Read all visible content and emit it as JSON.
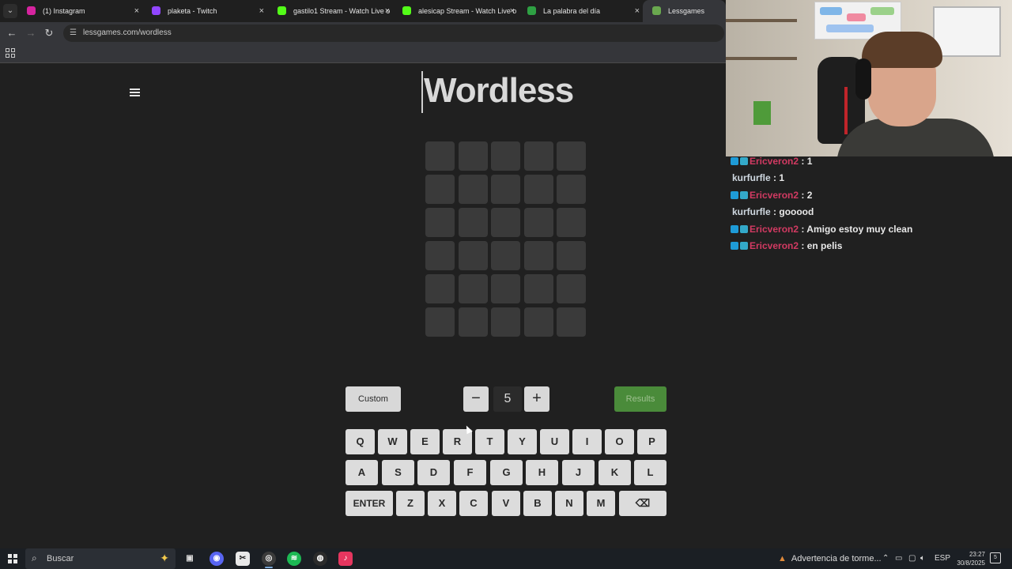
{
  "browser": {
    "tabs": [
      {
        "title": "(1) Instagram",
        "icon": "instagram-icon",
        "color": "#d6249f"
      },
      {
        "title": "plaketa - Twitch",
        "icon": "twitch-icon",
        "color": "#9146ff"
      },
      {
        "title": "gastilo1 Stream - Watch Live o",
        "icon": "kick-icon",
        "color": "#53fc18"
      },
      {
        "title": "alesicap Stream - Watch Live o",
        "icon": "kick-icon",
        "color": "#53fc18"
      },
      {
        "title": "La palabra del día",
        "icon": "p-logo-icon",
        "color": "#2ea043"
      },
      {
        "title": "Lessgames",
        "icon": "lessgames-icon",
        "color": "#6aa84f"
      }
    ],
    "url": "lessgames.com/wordless"
  },
  "game": {
    "title": "Wordless",
    "rows": 6,
    "cols": 5,
    "custom_label": "Custom",
    "minus_label": "−",
    "plus_label": "+",
    "word_length": "5",
    "results_label": "Results",
    "keyboard": {
      "row1": [
        "Q",
        "W",
        "E",
        "R",
        "T",
        "Y",
        "U",
        "I",
        "O",
        "P"
      ],
      "row2": [
        "A",
        "S",
        "D",
        "F",
        "G",
        "H",
        "J",
        "K",
        "L"
      ],
      "row3": [
        "ENTER",
        "Z",
        "X",
        "C",
        "V",
        "B",
        "N",
        "M",
        "⌫"
      ]
    }
  },
  "chat": {
    "messages": [
      {
        "user": "Ericveron2",
        "text": ": 1",
        "badges": true
      },
      {
        "user": "kurfurfle",
        "text": ": 1",
        "badges": false
      },
      {
        "user": "Ericveron2",
        "text": ": 2",
        "badges": true
      },
      {
        "user": "kurfurfle",
        "text": ": gooood",
        "badges": false
      },
      {
        "user": "Ericveron2",
        "text": ": Amigo estoy muy clean",
        "badges": true
      },
      {
        "user": "Ericveron2",
        "text": ": en pelis",
        "badges": true
      }
    ]
  },
  "taskbar": {
    "search_placeholder": "Buscar",
    "notice": "Advertencia de torme...",
    "language": "ESP",
    "time": "23:27",
    "date": "30/8/2025",
    "notification_count": "5"
  }
}
